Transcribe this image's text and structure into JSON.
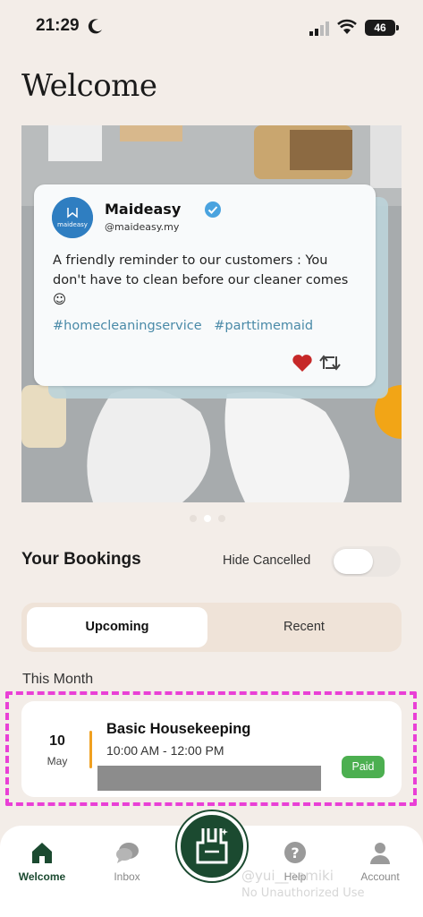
{
  "status_bar": {
    "time": "21:29",
    "battery": "46"
  },
  "page": {
    "title": "Welcome"
  },
  "banner": {
    "tweet": {
      "avatar_text": "maideasy",
      "name": "Maideasy",
      "handle": "@maideasy.my",
      "text": "A friendly reminder to our customers : You don't have to clean before our cleaner comes ☺",
      "hashtags": [
        "#homecleaningservice",
        "#parttimemaid"
      ]
    },
    "page_count": 3,
    "active_page": 2
  },
  "bookings": {
    "title": "Your Bookings",
    "hide_cancelled_label": "Hide Cancelled",
    "hide_cancelled": false,
    "tabs": [
      {
        "label": "Upcoming",
        "active": true
      },
      {
        "label": "Recent",
        "active": false
      }
    ],
    "section_label": "This Month",
    "items": [
      {
        "day": "10",
        "month": "May",
        "title": "Basic Housekeeping",
        "time": "10:00 AM - 12:00 PM",
        "status": "Paid"
      }
    ]
  },
  "tabbar": {
    "items": [
      {
        "label": "Welcome",
        "icon": "home-icon",
        "active": true
      },
      {
        "label": "Inbox",
        "icon": "chat-icon",
        "active": false
      },
      {
        "label": "",
        "icon": "maid-apron-icon",
        "active": false
      },
      {
        "label": "Help",
        "icon": "help-icon",
        "active": false
      },
      {
        "label": "Account",
        "icon": "account-icon",
        "active": false
      }
    ]
  },
  "watermark": {
    "line1": "@yui__namiki",
    "line2": "No Unauthorized Use"
  },
  "colors": {
    "background": "#f3ede8",
    "brand_green": "#1b4a30",
    "accent_orange": "#f0a020",
    "paid_green": "#4caf50",
    "highlight_magenta": "#e940d6",
    "hashtag_blue": "#4a8aa8"
  }
}
